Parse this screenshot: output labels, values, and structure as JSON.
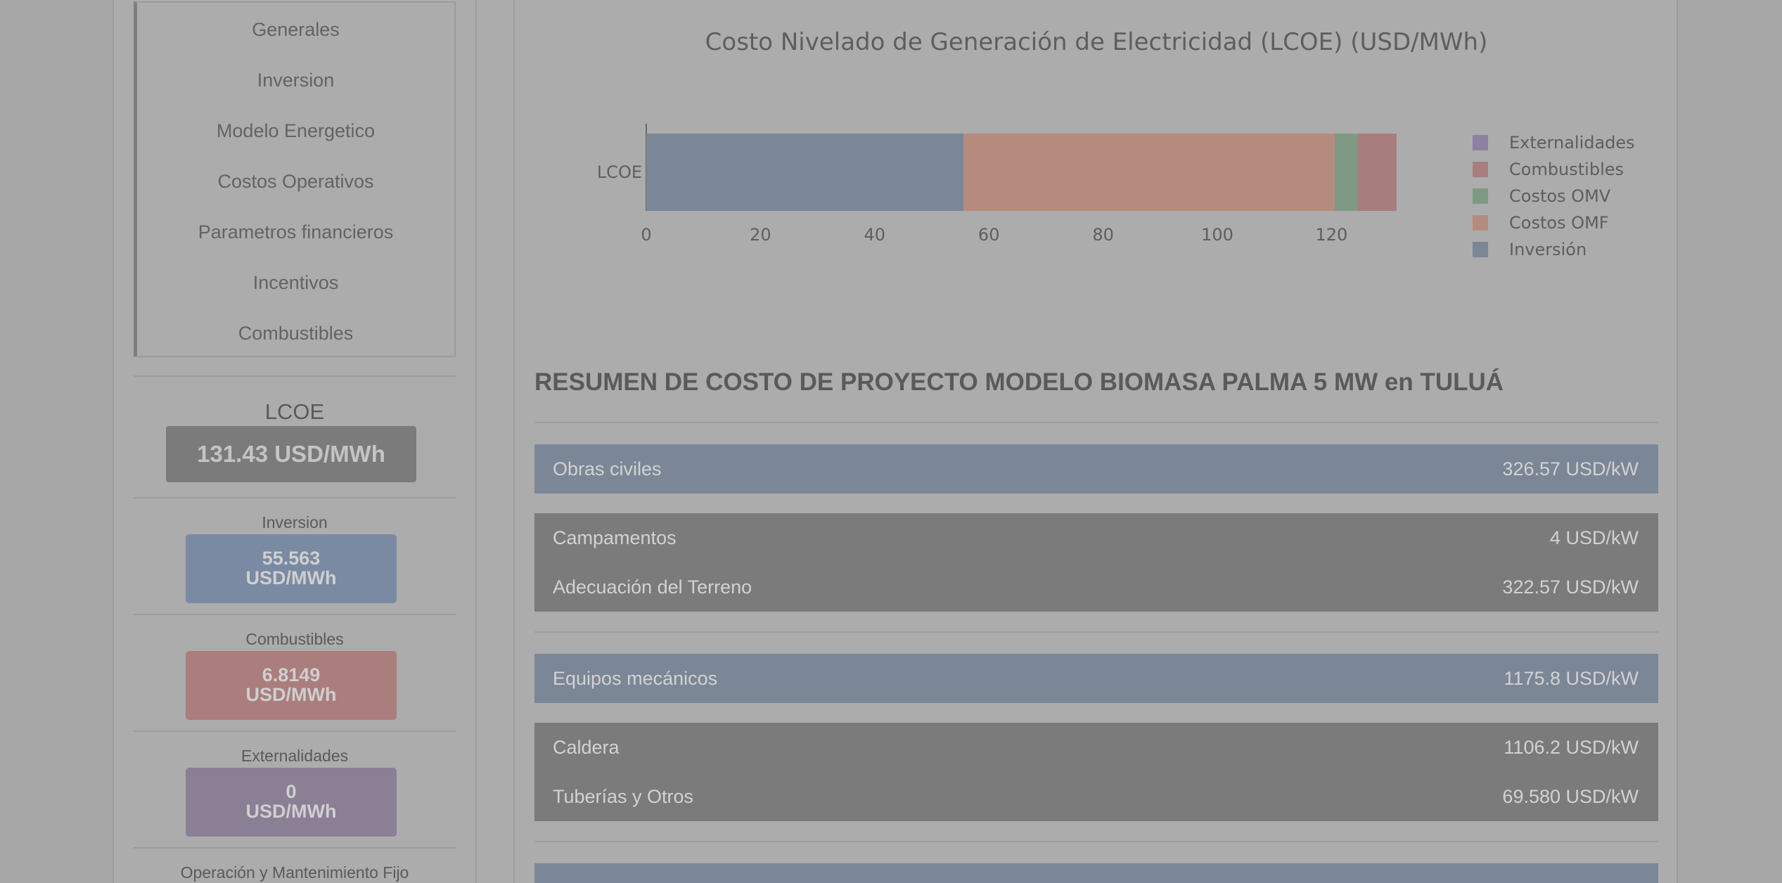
{
  "sidebar": {
    "nav": [
      "Generales",
      "Inversion",
      "Modelo Energetico",
      "Costos Operativos",
      "Parametros financieros",
      "Incentivos",
      "Combustibles"
    ],
    "lcoe": {
      "label": "LCOE",
      "value": "131.43 USD/MWh"
    },
    "metrics": [
      {
        "label": "Inversion",
        "value": "55.563",
        "unit": "USD/MWh",
        "color": "#7b8aa3"
      },
      {
        "label": "Combustibles",
        "value": "6.8149",
        "unit": "USD/MWh",
        "color": "#ab7d7d"
      },
      {
        "label": "Externalidades",
        "value": "0",
        "unit": "USD/MWh",
        "color": "#8a7f95"
      }
    ],
    "next_label": "Operación y Mantenimiento Fijo"
  },
  "chart_data": {
    "type": "bar",
    "orientation": "horizontal",
    "stacked": true,
    "title": "Costo Nivelado de Generación de Electricidad (LCOE) (USD/MWh)",
    "categories": [
      "LCOE"
    ],
    "xlim": [
      0,
      140
    ],
    "xticks": [
      0,
      20,
      40,
      60,
      80,
      100,
      120
    ],
    "series": [
      {
        "name": "Inversión",
        "values": [
          55.563
        ],
        "color": "#7b8797"
      },
      {
        "name": "Costos OMF",
        "values": [
          65.0
        ],
        "color": "#b58b7e"
      },
      {
        "name": "Costos OMV",
        "values": [
          4.0
        ],
        "color": "#7f9a84"
      },
      {
        "name": "Combustibles",
        "values": [
          6.8149
        ],
        "color": "#a87d7d"
      },
      {
        "name": "Externalidades",
        "values": [
          0
        ],
        "color": "#8e80a0"
      }
    ],
    "legend_order": [
      "Externalidades",
      "Combustibles",
      "Costos OMV",
      "Costos OMF",
      "Inversión"
    ],
    "legend_position": "right"
  },
  "summary": {
    "title": "RESUMEN DE COSTO DE PROYECTO MODELO BIOMASA PALMA 5 MW en TULUÁ",
    "sections": [
      {
        "label": "Obras civiles",
        "value": "326.57 USD/kW",
        "items": [
          {
            "label": "Campamentos",
            "value": "4 USD/kW"
          },
          {
            "label": "Adecuación del Terreno",
            "value": "322.57 USD/kW"
          }
        ]
      },
      {
        "label": "Equipos mecánicos",
        "value": "1175.8 USD/kW",
        "items": [
          {
            "label": "Caldera",
            "value": "1106.2 USD/kW"
          },
          {
            "label": "Tuberías y Otros",
            "value": "69.580 USD/kW"
          }
        ]
      }
    ]
  }
}
